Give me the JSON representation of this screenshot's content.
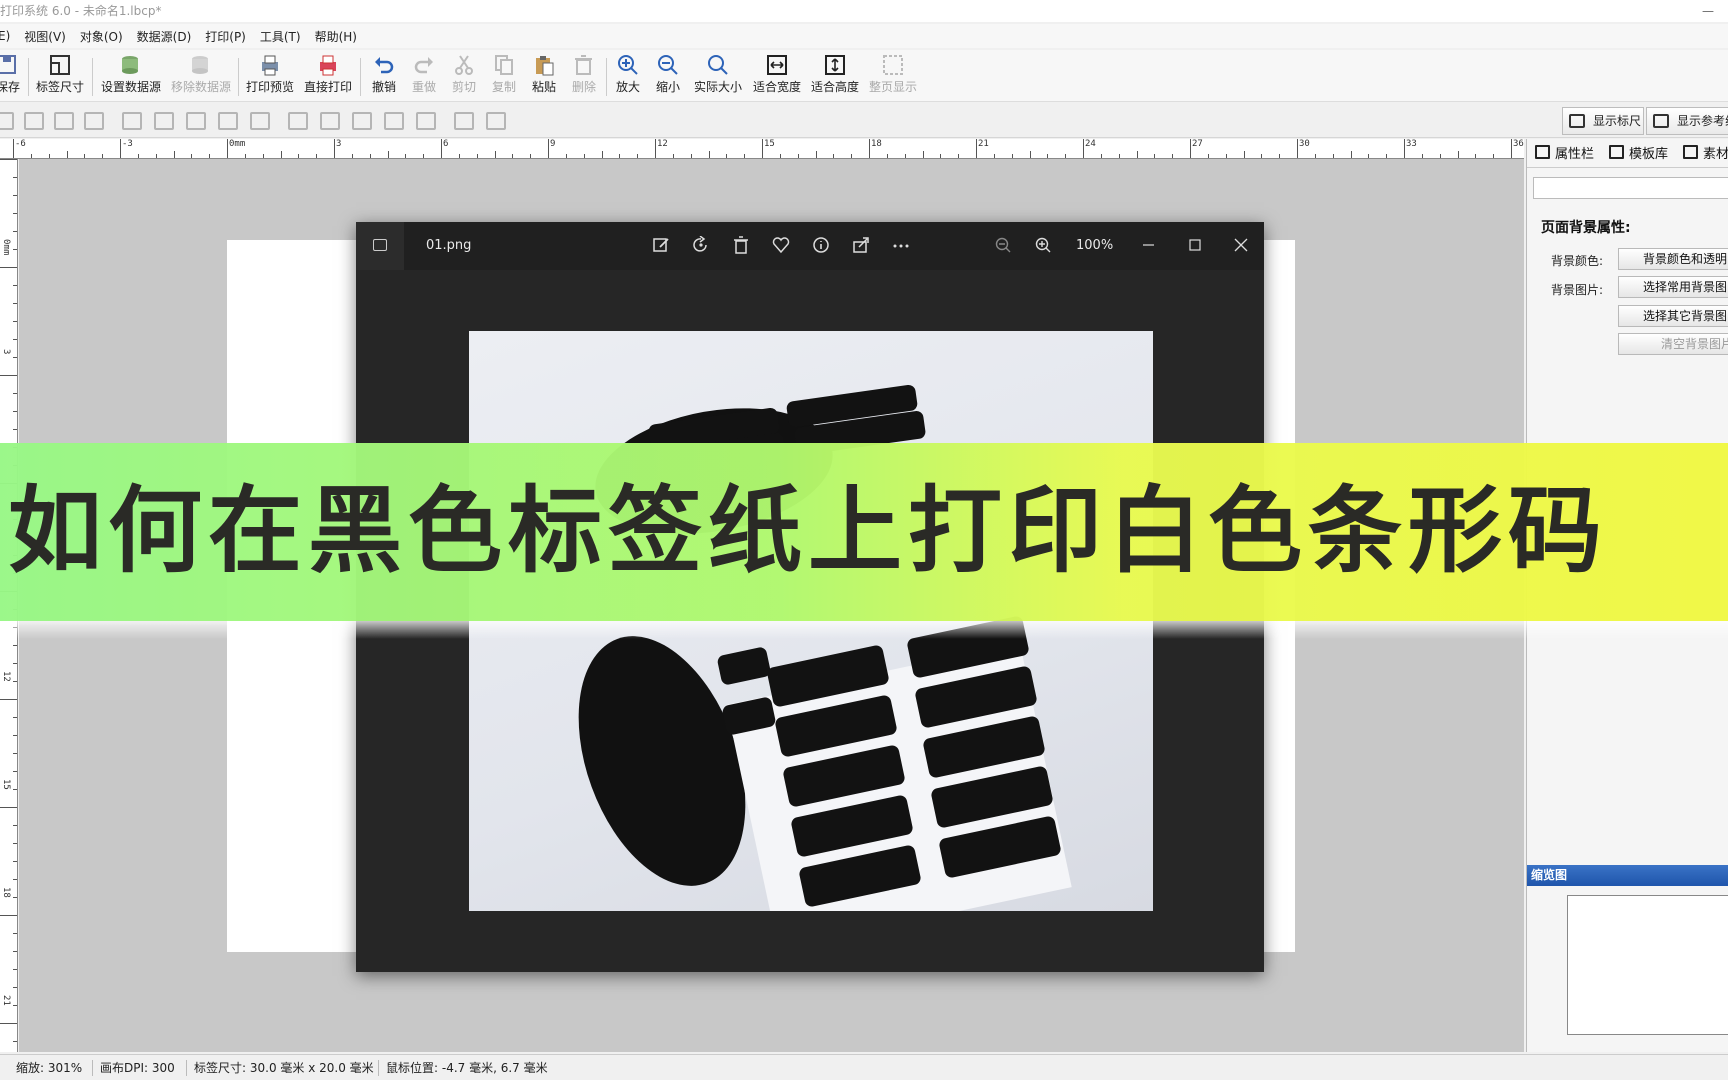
{
  "window": {
    "title": "打印系统 6.0 - 未命名1.lbcp*",
    "minimize_glyph": "—"
  },
  "menu": [
    "E)",
    "视图(V)",
    "对象(O)",
    "数据源(D)",
    "打印(P)",
    "工具(T)",
    "帮助(H)"
  ],
  "toolbar": {
    "save": "保存",
    "label_size": "标签尺寸",
    "set_datasource": "设置数据源",
    "remove_datasource": "移除数据源",
    "print_preview": "打印预览",
    "direct_print": "直接打印",
    "undo": "撤销",
    "redo": "重做",
    "cut": "剪切",
    "copy": "复制",
    "paste": "粘贴",
    "delete": "删除",
    "zoom_in": "放大",
    "zoom_out": "缩小",
    "actual_size": "实际大小",
    "fit_width": "适合宽度",
    "fit_height": "适合高度",
    "full_page": "整页显示"
  },
  "toolbar2": {
    "show_ruler": "显示标尺",
    "show_guides": "显示参考线"
  },
  "ruler": {
    "h_labels": [
      "-6",
      "-3",
      "0mm",
      "3",
      "6",
      "9",
      "12",
      "15",
      "18",
      "21",
      "24",
      "27",
      "30",
      "33",
      "36"
    ],
    "v_labels": [
      "0mm",
      "3",
      "12",
      "15",
      "18",
      "21"
    ]
  },
  "viewer": {
    "filename": "01.png",
    "zoom": "100%",
    "icons": [
      "edit-icon",
      "rotate-icon",
      "trash-icon",
      "heart-icon",
      "info-icon",
      "share-icon",
      "more-icon"
    ]
  },
  "banner": {
    "text": "如何在黑色标签纸上打印白色条形码"
  },
  "panel": {
    "tabs": [
      "属性栏",
      "模板库",
      "素材"
    ],
    "section_title": "页面背景属性:",
    "bg_color_label": "背景颜色:",
    "bg_image_label": "背景图片:",
    "btn_bg_color": "背景颜色和透明",
    "btn_common_bg": "选择常用背景图",
    "btn_other_bg": "选择其它背景图",
    "btn_clear_bg": "清空背景图片",
    "thumbnail_title": "缩览图"
  },
  "status": {
    "zoom": "缩放: 301%",
    "dpi": "画布DPI: 300",
    "label_size": "标签尺寸: 30.0 毫米 x 20.0 毫米",
    "mouse_pos": "鼠标位置: -4.7 毫米, 6.7 毫米"
  }
}
